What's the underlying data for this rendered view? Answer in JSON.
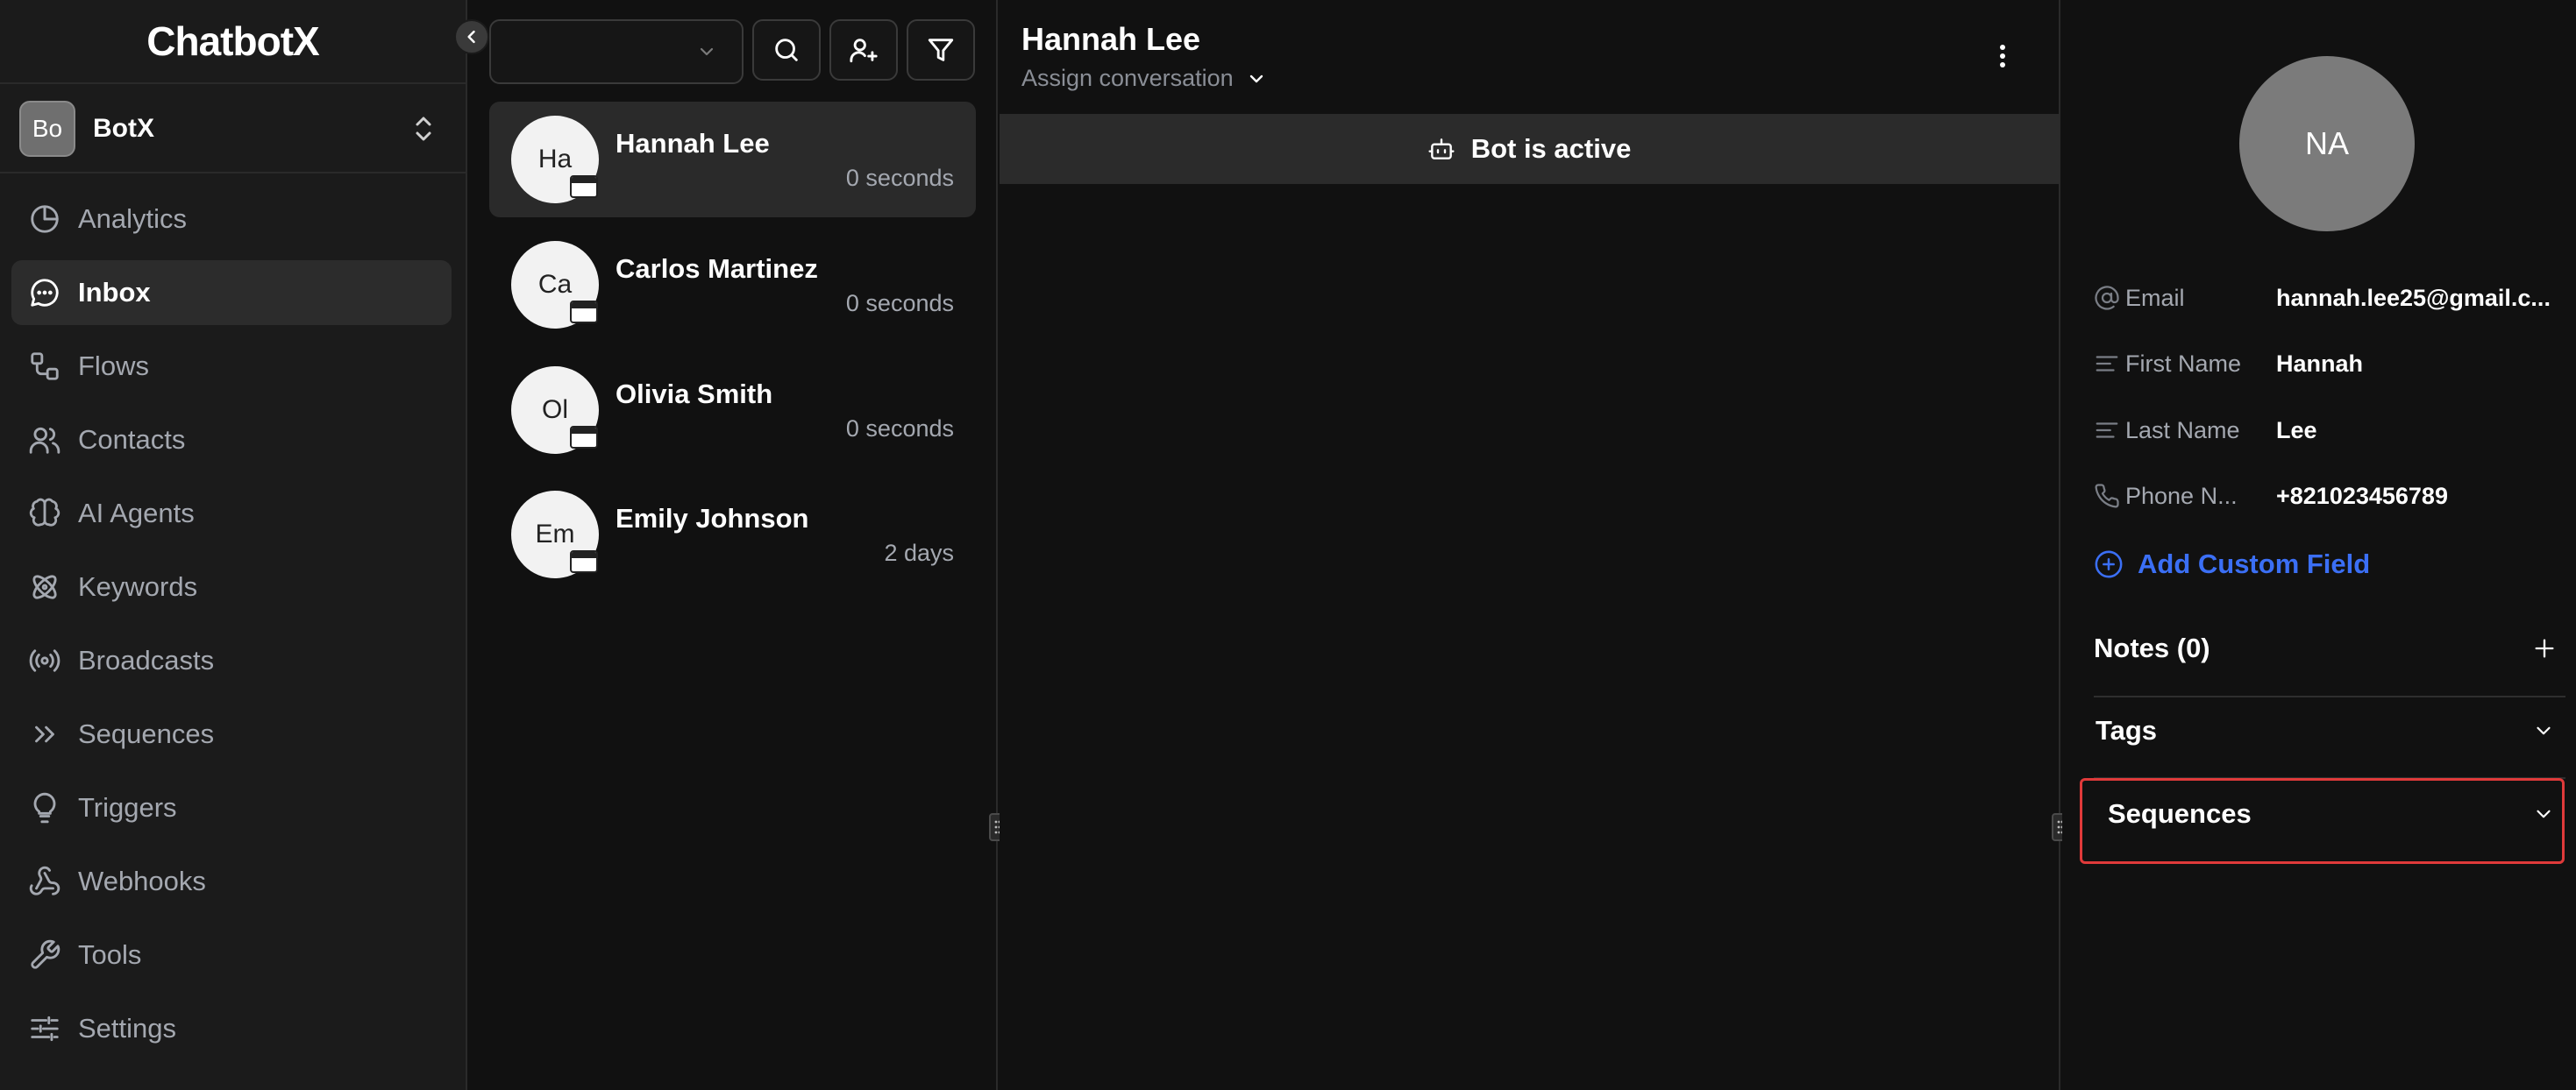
{
  "sidebar": {
    "logo": "ChatbotX",
    "workspace": {
      "avatar": "Bo",
      "name": "BotX"
    },
    "items": [
      {
        "label": "Analytics",
        "icon": "pie-chart-icon"
      },
      {
        "label": "Inbox",
        "icon": "chat-bubble-icon",
        "active": true
      },
      {
        "label": "Flows",
        "icon": "flow-icon"
      },
      {
        "label": "Contacts",
        "icon": "users-icon"
      },
      {
        "label": "AI Agents",
        "icon": "brain-icon"
      },
      {
        "label": "Keywords",
        "icon": "atom-icon"
      },
      {
        "label": "Broadcasts",
        "icon": "broadcast-icon"
      },
      {
        "label": "Sequences",
        "icon": "double-chevron-icon"
      },
      {
        "label": "Triggers",
        "icon": "lightbulb-icon"
      },
      {
        "label": "Webhooks",
        "icon": "webhook-icon"
      },
      {
        "label": "Tools",
        "icon": "wrench-icon"
      },
      {
        "label": "Settings",
        "icon": "sliders-icon"
      }
    ]
  },
  "conversations": [
    {
      "initials": "Ha",
      "name": "Hannah Lee",
      "time": "0 seconds"
    },
    {
      "initials": "Ca",
      "name": "Carlos Martinez",
      "time": "0 seconds"
    },
    {
      "initials": "Ol",
      "name": "Olivia Smith",
      "time": "0 seconds"
    },
    {
      "initials": "Em",
      "name": "Emily Johnson",
      "time": "2 days"
    }
  ],
  "chat": {
    "title": "Hannah Lee",
    "assign_label": "Assign conversation",
    "bot_status": "Bot is active"
  },
  "contact": {
    "avatar": "NA",
    "fields": [
      {
        "label": "Email",
        "value": "hannah.lee25@gmail.c...",
        "icon": "at-icon"
      },
      {
        "label": "First Name",
        "value": "Hannah",
        "icon": "text-lines-icon"
      },
      {
        "label": "Last Name",
        "value": "Lee",
        "icon": "text-lines-icon"
      },
      {
        "label": "Phone N...",
        "value": "+821023456789",
        "icon": "phone-icon"
      }
    ],
    "add_field_label": "Add Custom Field",
    "notes_label": "Notes (0)",
    "tags_label": "Tags",
    "sequences_label": "Sequences"
  },
  "colors": {
    "accent_blue": "#3b6ff5",
    "highlight_red": "#e03a3a",
    "background": "#111111",
    "sidebar": "#1b1b1b"
  }
}
